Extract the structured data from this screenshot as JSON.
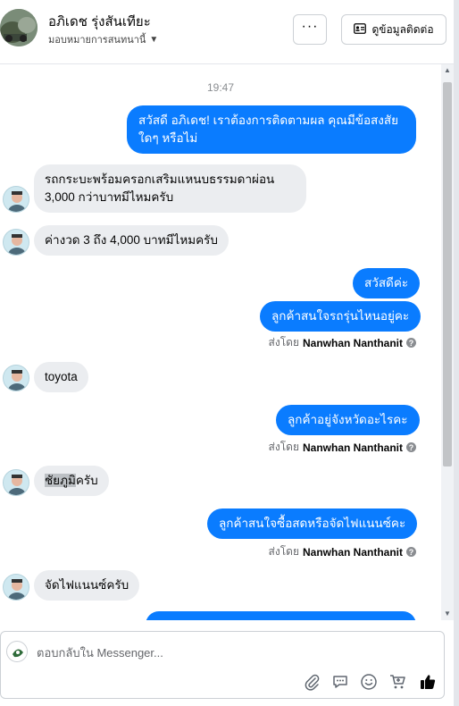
{
  "header": {
    "name": "อภิเดช รุ่งสันเทียะ",
    "assign_label": "มอบหมายการสนทนานี้",
    "more_label": "···",
    "contact_button": "ดูข้อมูลติดต่อ"
  },
  "chat": {
    "timestamp": "19:47",
    "messages": {
      "m1": "สวัสดี อภิเดช! เราต้องการติดตามผล คุณมีข้อสงสัยใดๆ หรือไม่",
      "m2": "รถกระบะพร้อมครอกเสริมแหนบธรรมดาผ่อน 3,000 กว่าบาทมีไหมครับ",
      "m3": "ค่างวด 3 ถึง 4,000 บาทมีไหมครับ",
      "m4": "สวัสดีค่ะ",
      "m5": "ลูกค้าสนใจรถรุ่นไหนอยู่คะ",
      "m6": "toyota",
      "m7": "ลูกค้าอยู่จังหวัดอะไรคะ",
      "m8a": "ชัยภูมิ",
      "m8b": "ครับ",
      "m9": "ลูกค้าสนใจซื้อสดหรือจัดไฟแนนซ์คะ",
      "m10": "จัดไฟแนนซ์ครับ"
    },
    "sent_by_prefix": "ส่งโดย",
    "sent_by_name": "Nanwhan Nanthanit",
    "help_glyph": "?"
  },
  "composer": {
    "placeholder": "ตอบกลับใน Messenger..."
  },
  "colors": {
    "outgoing": "#0a7cff",
    "incoming": "#ebedf0",
    "meta": "#65676b"
  },
  "icons": [
    "ellipsis-icon",
    "contact-card-icon",
    "chevron-down-icon",
    "help-icon",
    "attachment-icon",
    "saved-reply-icon",
    "emoji-icon",
    "cart-icon",
    "like-icon"
  ]
}
